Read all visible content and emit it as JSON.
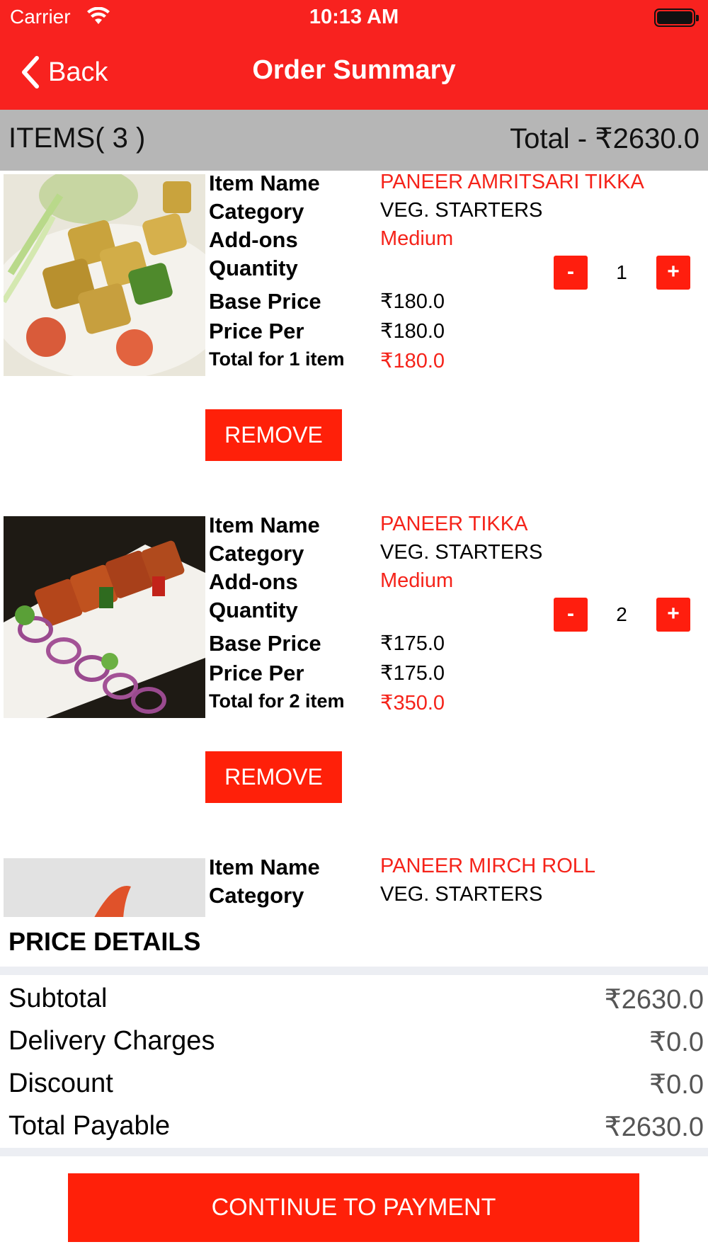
{
  "status_bar": {
    "carrier": "Carrier",
    "time": "10:13 AM"
  },
  "nav": {
    "back_label": "Back",
    "title": "Order Summary"
  },
  "summary": {
    "items_label": "ITEMS( 3 )",
    "total_label": "Total - ₹2630.0"
  },
  "items": [
    {
      "labels": {
        "name": "Item Name",
        "category": "Category",
        "addons": "Add-ons",
        "quantity": "Quantity",
        "base_price": "Base Price",
        "price_per": "Price Per",
        "total": "Total for 1 item"
      },
      "name": "PANEER AMRITSARI TIKKA",
      "category": "VEG. STARTERS",
      "addons": "Medium",
      "quantity": "1",
      "minus": "-",
      "plus": "+",
      "base_price": "₹180.0",
      "price_per": "₹180.0",
      "total": "₹180.0",
      "remove_label": "REMOVE",
      "image": "paneer-amritsari-tikka-photo"
    },
    {
      "labels": {
        "name": "Item Name",
        "category": "Category",
        "addons": "Add-ons",
        "quantity": "Quantity",
        "base_price": "Base Price",
        "price_per": "Price Per",
        "total": "Total for 2 item"
      },
      "name": "PANEER TIKKA",
      "category": "VEG. STARTERS",
      "addons": "Medium",
      "quantity": "2",
      "minus": "-",
      "plus": "+",
      "base_price": "₹175.0",
      "price_per": "₹175.0",
      "total": "₹350.0",
      "remove_label": "REMOVE",
      "image": "paneer-tikka-photo"
    },
    {
      "labels": {
        "name": "Item Name",
        "category": "Category"
      },
      "name": "PANEER MIRCH ROLL",
      "category": "VEG. STARTERS",
      "image": "paneer-mirch-roll-photo"
    }
  ],
  "price_details": {
    "title": "PRICE DETAILS",
    "rows": [
      {
        "label": "Subtotal",
        "value": "₹2630.0"
      },
      {
        "label": "Delivery Charges",
        "value": "₹0.0"
      },
      {
        "label": "Discount",
        "value": "₹0.0"
      },
      {
        "label": "Total Payable",
        "value": "₹2630.0"
      }
    ]
  },
  "cta": {
    "label": "CONTINUE TO PAYMENT"
  },
  "colors": {
    "brand_red": "#f8221f",
    "button_red": "#ff2009",
    "text_red": "#f5231a",
    "summary_bar": "#b6b6b6"
  },
  "icons": {
    "back": "chevron-left-icon",
    "wifi": "wifi-icon",
    "battery": "battery-icon"
  }
}
